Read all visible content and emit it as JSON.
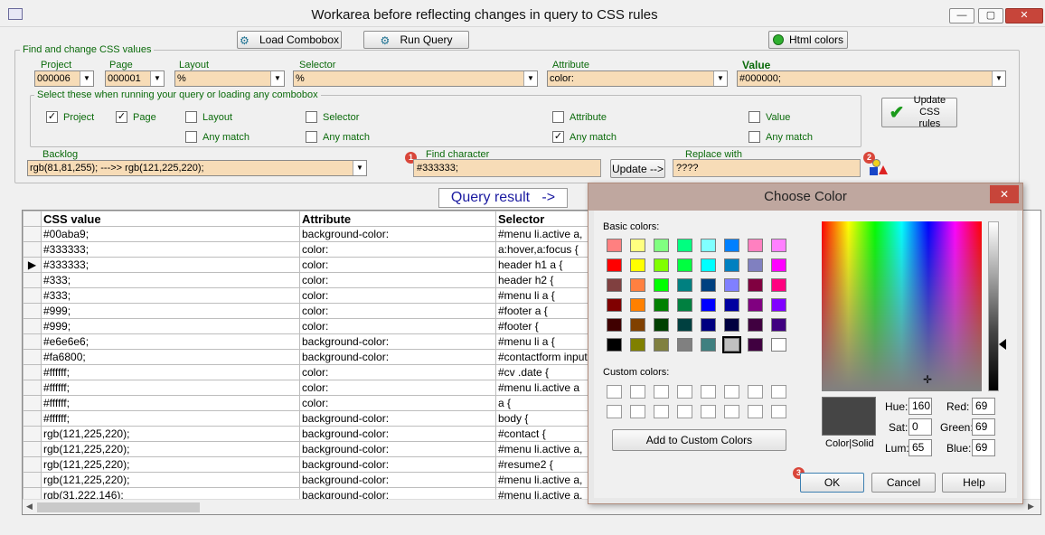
{
  "window": {
    "title": "Workarea before reflecting changes in query to CSS rules",
    "min": "—",
    "max": "▢",
    "close": "✕"
  },
  "toolbar": {
    "load_combobox": "Load Combobox",
    "run_query": "Run Query",
    "html_colors": "Html colors"
  },
  "find_group": {
    "title": "Find and change CSS values",
    "fields": {
      "project": {
        "label": "Project",
        "value": "000006"
      },
      "page": {
        "label": "Page",
        "value": "000001"
      },
      "layout": {
        "label": "Layout",
        "value": "%"
      },
      "selector": {
        "label": "Selector",
        "value": "%"
      },
      "attribute": {
        "label": "Attribute",
        "value": "color:"
      },
      "value": {
        "label": "Value",
        "value": "#000000;"
      }
    },
    "select_group": {
      "title": "Select these when running your query or loading any combobox",
      "checks": {
        "project": {
          "label": "Project",
          "mark": "✓"
        },
        "page": {
          "label": "Page",
          "mark": "✓"
        },
        "layout": {
          "label": "Layout",
          "mark": ""
        },
        "selector": {
          "label": "Selector",
          "mark": ""
        },
        "attribute": {
          "label": "Attribute",
          "mark": ""
        },
        "value": {
          "label": "Value",
          "mark": ""
        },
        "layout_any": {
          "label": "Any match",
          "mark": ""
        },
        "selector_any": {
          "label": "Any match",
          "mark": ""
        },
        "attribute_any": {
          "label": "Any match",
          "mark": "✓"
        },
        "value_any": {
          "label": "Any match",
          "mark": ""
        }
      }
    },
    "update_css_rules": "Update CSS rules",
    "backlog": {
      "label": "Backlog",
      "value": "rgb(81,81,255); --->> rgb(121,225,220);"
    },
    "find_char": {
      "label": "Find character",
      "value": "#333333;",
      "badge": "1"
    },
    "update_btn": "Update -->",
    "replace": {
      "label": "Replace with",
      "value": "????",
      "badge": "2"
    }
  },
  "query_result": "Query result   ->",
  "grid": {
    "columns": [
      "CSS value",
      "Attribute",
      "Selector"
    ],
    "current_row_marker": "▶",
    "rows": [
      [
        "#00aba9;",
        "background-color:",
        "#menu li.active a,"
      ],
      [
        "#333333;",
        "color:",
        "a:hover,a:focus {"
      ],
      [
        "#333333;",
        "color:",
        "header h1 a {"
      ],
      [
        "#333;",
        "color:",
        "header h2 {"
      ],
      [
        "#333;",
        "color:",
        "#menu li a {"
      ],
      [
        "#999;",
        "color:",
        "#footer a {"
      ],
      [
        "#999;",
        "color:",
        "#footer {"
      ],
      [
        "#e6e6e6;",
        "background-color:",
        "#menu li a {"
      ],
      [
        "#fa6800;",
        "background-color:",
        "#contactform input"
      ],
      [
        "#ffffff;",
        "color:",
        "#cv .date {"
      ],
      [
        "#ffffff;",
        "color:",
        "#menu li.active a"
      ],
      [
        "#ffffff;",
        "color:",
        "a {"
      ],
      [
        "#ffffff;",
        "background-color:",
        "body {"
      ],
      [
        "rgb(121,225,220);",
        "background-color:",
        "#contact {"
      ],
      [
        "rgb(121,225,220);",
        "background-color:",
        "#menu li.active a,"
      ],
      [
        "rgb(121,225,220);",
        "background-color:",
        "#resume2 {"
      ],
      [
        "rgb(121,225,220);",
        "background-color:",
        "#menu li.active a,"
      ],
      [
        "rgb(31,222,146);",
        "background-color:",
        "#menu li.active a,"
      ]
    ]
  },
  "dialog": {
    "title": "Choose Color",
    "basic_colors_label": "Basic colors:",
    "custom_colors_label": "Custom colors:",
    "add_custom": "Add to Custom Colors",
    "color_solid": "Color|Solid",
    "hue": {
      "label": "Hue:",
      "value": "160"
    },
    "sat": {
      "label": "Sat:",
      "value": "0"
    },
    "lum": {
      "label": "Lum:",
      "value": "65"
    },
    "red": {
      "label": "Red:",
      "value": "69"
    },
    "green": {
      "label": "Green:",
      "value": "69"
    },
    "blue": {
      "label": "Blue:",
      "value": "69"
    },
    "ok": "OK",
    "cancel": "Cancel",
    "help": "Help",
    "ok_badge": "3",
    "preview_color": "#454545",
    "basic_colors": [
      "#ff8080",
      "#ffff80",
      "#80ff80",
      "#00ff80",
      "#80ffff",
      "#0080ff",
      "#ff80c0",
      "#ff80ff",
      "#ff0000",
      "#ffff00",
      "#80ff00",
      "#00ff40",
      "#00ffff",
      "#0080c0",
      "#8080c0",
      "#ff00ff",
      "#804040",
      "#ff8040",
      "#00ff00",
      "#008080",
      "#004080",
      "#8080ff",
      "#800040",
      "#ff0080",
      "#800000",
      "#ff8000",
      "#008000",
      "#008040",
      "#0000ff",
      "#0000a0",
      "#800080",
      "#8000ff",
      "#400000",
      "#804000",
      "#004000",
      "#004040",
      "#000080",
      "#000040",
      "#400040",
      "#400080",
      "#000000",
      "#808000",
      "#808040",
      "#808080",
      "#408080",
      "#c0c0c0",
      "#400040",
      "#ffffff"
    ]
  }
}
